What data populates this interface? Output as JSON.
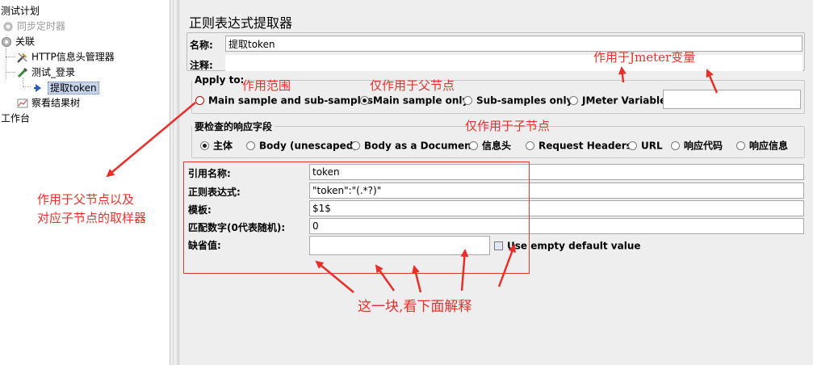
{
  "tree": {
    "items": [
      {
        "label": "测试计划",
        "icon": "test-plan-icon",
        "state": "normal"
      },
      {
        "label": "同步定时器",
        "icon": "gear-icon",
        "state": "disabled"
      },
      {
        "label": "关联",
        "icon": "gear-icon",
        "state": "normal"
      },
      {
        "label": "HTTP信息头管理器",
        "icon": "wrench-icon",
        "state": "normal"
      },
      {
        "label": "测试_登录",
        "icon": "pipette-icon",
        "state": "normal"
      },
      {
        "label": "提取token",
        "icon": "arrow-icon",
        "state": "selected"
      },
      {
        "label": "察看结果树",
        "icon": "chart-icon",
        "state": "normal"
      },
      {
        "label": "工作台",
        "icon": "",
        "state": "normal"
      }
    ]
  },
  "panel": {
    "title": "正则表达式提取器",
    "name_label": "名称:",
    "name_value": "提取token",
    "comment_label": "注释:",
    "comment_value": "",
    "apply_to": {
      "title": "Apply to:",
      "options": [
        {
          "label": "Main sample and sub-samples",
          "selected": false
        },
        {
          "label": "Main sample only",
          "selected": true
        },
        {
          "label": "Sub-samples only",
          "selected": false
        },
        {
          "label": "JMeter Variable",
          "selected": false
        }
      ],
      "variable_value": ""
    },
    "response_field": {
      "title": "要检查的响应字段",
      "options": [
        {
          "label": "主体",
          "selected": true
        },
        {
          "label": "Body (unescaped)",
          "selected": false
        },
        {
          "label": "Body as a Document",
          "selected": false
        },
        {
          "label": "信息头",
          "selected": false
        },
        {
          "label": "Request Headers",
          "selected": false
        },
        {
          "label": "URL",
          "selected": false
        },
        {
          "label": "响应代码",
          "selected": false
        },
        {
          "label": "响应信息",
          "selected": false
        }
      ]
    },
    "fields": [
      {
        "label": "引用名称:",
        "value": "token"
      },
      {
        "label": "正则表达式:",
        "value": "\"token\":\"(.*?)\""
      },
      {
        "label": "模板:",
        "value": "$1$"
      },
      {
        "label": "匹配数字(0代表随机):",
        "value": "0"
      },
      {
        "label": "缺省值:",
        "value": ""
      }
    ],
    "use_empty_label": "Use empty default value"
  },
  "annotations": {
    "scope": "作用范围",
    "parent_only": "仅作用于父节点",
    "jmeter_var": "作用于Jmeter变量",
    "child_only": "仅作用于子节点",
    "parent_and_child_line1": "作用于父节点以及",
    "parent_and_child_line2": "对应子节点的取样器",
    "block_note": "这一块,看下面解释"
  },
  "colors": {
    "annotation": "#e8302b",
    "panel_bg": "#eeeeee",
    "selection": "#c5d4ea"
  }
}
